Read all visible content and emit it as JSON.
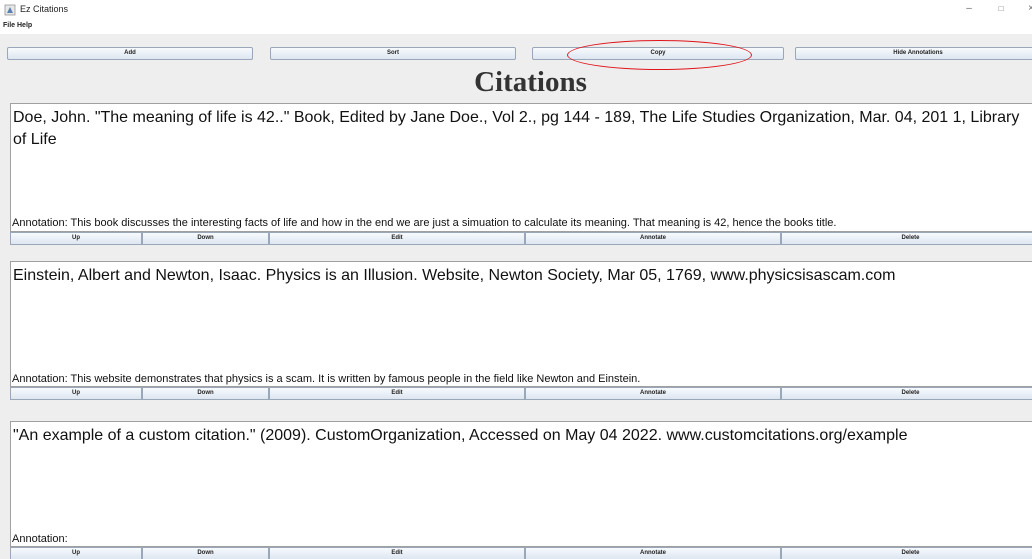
{
  "window": {
    "title": "Ez Citations",
    "minimize_glyph": "–",
    "maximize_glyph": "□",
    "close_glyph": "×"
  },
  "menu": {
    "file": "File",
    "help": "Help"
  },
  "toolbar": {
    "add": "Add",
    "sort": "Sort",
    "copy": "Copy",
    "hide_annotations": "Hide Annotations"
  },
  "heading": "Citations",
  "citations": [
    {
      "text": "Doe, John. \"The meaning of life is 42..\" Book, Edited by Jane Doe., Vol 2., pg 144 - 189, The Life Studies Organization, Mar. 04, 201 1, Library of Life",
      "annotation": "Annotation: This book discusses the interesting facts of life and how in the end we are just a simuation to calculate its meaning. That meaning is 42, hence the books title."
    },
    {
      "text": "Einstein, Albert and Newton, Isaac. Physics is an Illusion. Website, Newton Society, Mar 05, 1769, www.physicsisascam.com",
      "annotation": "Annotation: This website demonstrates that physics is a scam. It is written by famous people in the field like Newton and Einstein."
    },
    {
      "text": "\"An example of a custom citation.\" (2009). CustomOrganization, Accessed on May 04 2022. www.customcitations.org/example",
      "annotation": "Annotation:"
    }
  ],
  "row_buttons": {
    "up": "Up",
    "down": "Down",
    "edit": "Edit",
    "annotate": "Annotate",
    "delete": "Delete"
  },
  "colors": {
    "highlight_ellipse": "#e0141b",
    "window_bg": "#eeeeee"
  }
}
